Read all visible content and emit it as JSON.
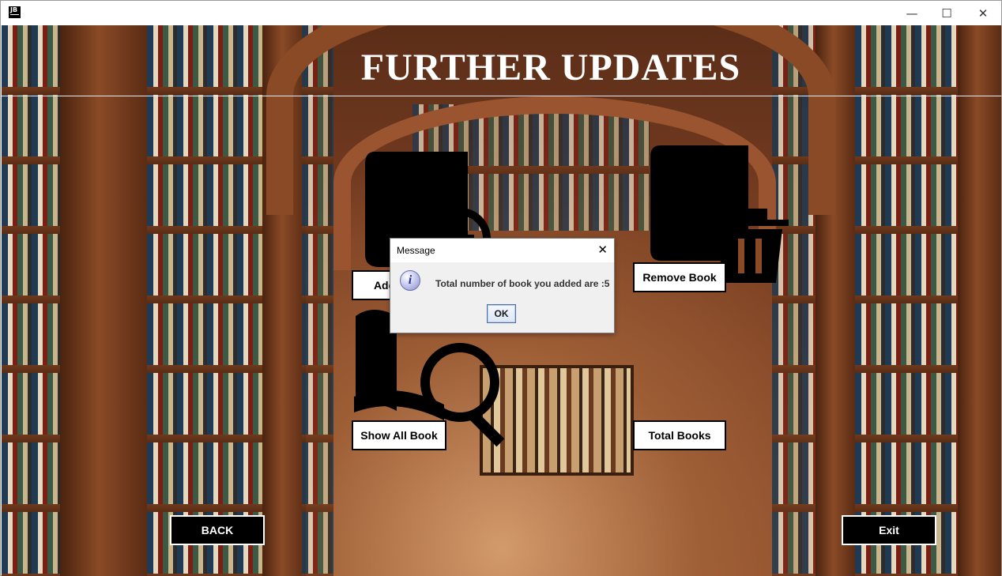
{
  "window": {
    "app_icon_text": "JB",
    "minimize_glyph": "—",
    "maximize_glyph": "☐",
    "close_glyph": "✕"
  },
  "page": {
    "title": "FURTHER UPDATES"
  },
  "buttons": {
    "add_book": "Add Book",
    "remove_book": "Remove Book",
    "show_all_book": "Show All Book",
    "total_books": "Total Books",
    "back": "BACK",
    "exit": "Exit"
  },
  "dialog": {
    "title": "Message",
    "close_glyph": "✕",
    "icon_glyph": "i",
    "message": "Total number of book you added are :5",
    "ok_label": "OK"
  },
  "icons": {
    "add_book": "book-add-icon",
    "remove_book": "book-trash-icon",
    "show_all_book": "book-search-icon",
    "info": "info-icon"
  },
  "colors": {
    "button_bg": "#ffffff",
    "button_dark_bg": "#000000",
    "title_text": "#ffffff",
    "dialog_bg": "#f0f0f0"
  }
}
